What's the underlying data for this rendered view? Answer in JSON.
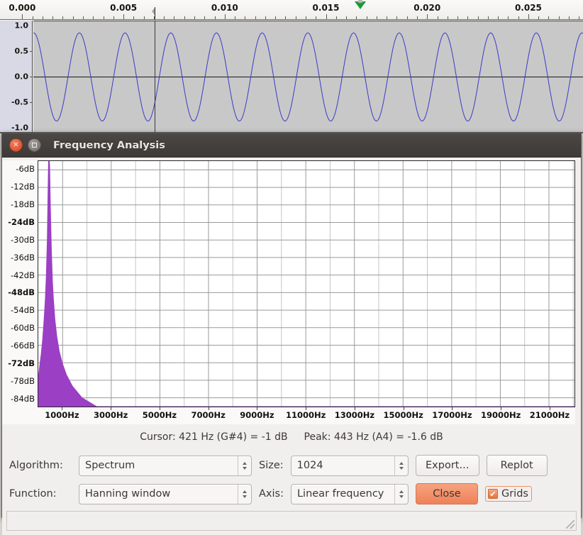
{
  "track": {
    "ruler": {
      "labels": [
        "0.000",
        "0.005",
        "0.010",
        "0.015",
        "0.020",
        "0.025"
      ],
      "label_times": [
        0.0,
        0.005,
        0.01,
        0.015,
        0.02,
        0.025
      ],
      "time_start": -0.0011,
      "time_end": 0.0277,
      "cursor_time": 0.00655,
      "playhead_time": 0.0167
    },
    "amplitude_axis": {
      "labels": [
        "1.0",
        "0.5",
        "0.0",
        "-0.5",
        "-1.0"
      ],
      "values": [
        1.0,
        0.5,
        0.0,
        -0.5,
        -1.0
      ]
    },
    "waveform": {
      "frequency_hz": 443,
      "amplitude": 0.88,
      "color": "#3a3ac8",
      "background": "#c8c8c8"
    }
  },
  "window": {
    "title": "Frequency Analysis",
    "close_icon": "close-icon",
    "maximize_icon": "maximize-icon"
  },
  "chart_data": {
    "type": "line",
    "title": "Frequency Analysis",
    "xlabel": "",
    "ylabel": "",
    "grid": true,
    "legend": "none",
    "xlim": [
      0,
      22050
    ],
    "ylim": [
      -87,
      -3
    ],
    "x_tick_labels": [
      "1000Hz",
      "3000Hz",
      "5000Hz",
      "7000Hz",
      "9000Hz",
      "11000Hz",
      "13000Hz",
      "15000Hz",
      "17000Hz",
      "19000Hz",
      "21000Hz"
    ],
    "x_tick_values": [
      1000,
      3000,
      5000,
      7000,
      9000,
      11000,
      13000,
      15000,
      17000,
      19000,
      21000
    ],
    "x_minor_values": [
      2000,
      4000,
      6000,
      8000,
      10000,
      12000,
      14000,
      16000,
      18000,
      20000,
      22000
    ],
    "y_tick_labels": [
      "-6dB",
      "-12dB",
      "-18dB",
      "-24dB",
      "-30dB",
      "-36dB",
      "-42dB",
      "-48dB",
      "-54dB",
      "-60dB",
      "-66dB",
      "-72dB",
      "-78dB",
      "-84dB"
    ],
    "y_tick_values": [
      -6,
      -12,
      -18,
      -24,
      -30,
      -36,
      -42,
      -48,
      -54,
      -60,
      -66,
      -72,
      -78,
      -84
    ],
    "y_bold_labels": [
      "-24dB",
      "-48dB",
      "-72dB"
    ],
    "fill_color": "#9b3fc4",
    "peak_frequency_hz": 443,
    "peak_level_db": -1.6,
    "noise_floor_db": -87,
    "series": [
      {
        "name": "Spectrum",
        "x": [
          0,
          60,
          120,
          180,
          240,
          290,
          330,
          370,
          400,
          421,
          443,
          465,
          500,
          540,
          580,
          620,
          680,
          760,
          860,
          980,
          1150,
          1400,
          1800,
          2400,
          3200,
          22050
        ],
        "y": [
          -77,
          -73,
          -69,
          -64,
          -57,
          -50,
          -42,
          -30,
          -14,
          -3.2,
          -1.6,
          -4.5,
          -20,
          -34,
          -44,
          -50,
          -57,
          -63,
          -68,
          -72,
          -76,
          -80,
          -84,
          -87,
          -87,
          -87
        ]
      }
    ]
  },
  "status": {
    "cursor_text": "Cursor: 421 Hz (G#4) = -1 dB",
    "peak_text": "Peak: 443 Hz (A4) = -1.6 dB"
  },
  "controls": {
    "algorithm_label": "Algorithm:",
    "algorithm_value": "Spectrum",
    "size_label": "Size:",
    "size_value": "1024",
    "function_label": "Function:",
    "function_value": "Hanning window",
    "axis_label": "Axis:",
    "axis_value": "Linear frequency",
    "export_label": "Export...",
    "replot_label": "Replot",
    "close_label": "Close",
    "grids_label": "Grids",
    "grids_checked": true,
    "grids_check_glyph": "✔"
  },
  "colors": {
    "accent_orange": "#ef8159",
    "spectrum_purple": "#9b3fc4",
    "waveform_blue": "#3a3ac8",
    "playhead_green": "#1a9b36"
  }
}
